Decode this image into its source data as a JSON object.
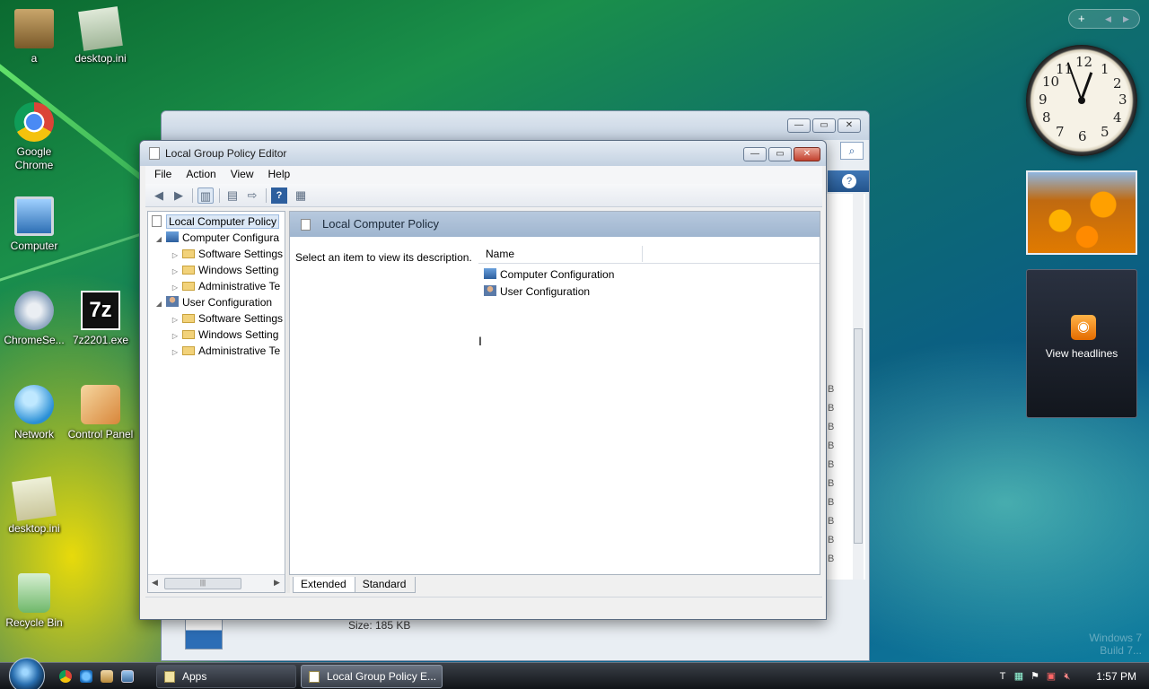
{
  "desktop": {
    "icons": [
      {
        "label": "a"
      },
      {
        "label": "desktop.ini"
      },
      {
        "label": "Google Chrome"
      },
      {
        "label": "Computer"
      },
      {
        "label": "ChromeSe..."
      },
      {
        "label": "7z2201.exe"
      },
      {
        "label": "Network"
      },
      {
        "label": "Control Panel"
      },
      {
        "label": "desktop.ini"
      },
      {
        "label": "Recycle Bin"
      }
    ],
    "watermark_line1": "Windows 7",
    "watermark_line2": "Build 7..."
  },
  "background_window": {
    "size_text": "Size:  185 KB",
    "column_letters": [
      "B",
      "B",
      "B",
      "B",
      "B",
      "B",
      "B",
      "B",
      "B",
      "B"
    ]
  },
  "window": {
    "title": "Local Group Policy Editor",
    "menu": [
      "File",
      "Action",
      "View",
      "Help"
    ],
    "tree": {
      "root": "Local Computer Policy",
      "computer_config": "Computer Configura",
      "computer_children": [
        "Software Settings",
        "Windows Setting",
        "Administrative Te"
      ],
      "user_config": "User Configuration",
      "user_children": [
        "Software Settings",
        "Windows Setting",
        "Administrative Te"
      ]
    },
    "right_pane": {
      "header_title": "Local Computer Policy",
      "description": "Select an item to view its description.",
      "column_name": "Name",
      "items": [
        "Computer Configuration",
        "User Configuration"
      ]
    },
    "tabs": [
      "Extended",
      "Standard"
    ]
  },
  "gadgets": {
    "clock_numbers": [
      "12",
      "1",
      "2",
      "3",
      "4",
      "5",
      "6",
      "7",
      "8",
      "9",
      "10",
      "11"
    ],
    "feed_label": "View headlines"
  },
  "taskbar": {
    "tasks": [
      "Apps",
      "Local Group Policy E..."
    ],
    "time": "1:57 PM"
  },
  "colors": {
    "accent": "#2d5f9e",
    "header_blue": "#a9bdd6",
    "taskbar": "#1f2329"
  }
}
